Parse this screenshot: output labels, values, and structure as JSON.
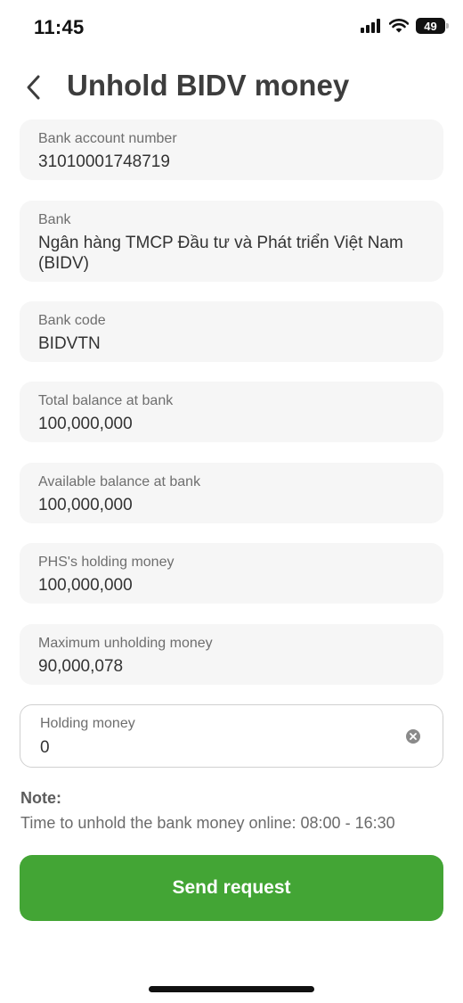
{
  "status_bar": {
    "time": "11:45",
    "battery_level": "49",
    "icons": [
      "signal-icon",
      "wifi-icon",
      "battery-icon"
    ]
  },
  "header": {
    "back_icon": "chevron-left-icon",
    "title": "Unhold BIDV money"
  },
  "fields": [
    {
      "label": "Bank account number",
      "value": "31010001748719"
    },
    {
      "label": "Bank",
      "value": "Ngân hàng TMCP Đầu tư và Phát triển Việt Nam (BIDV)"
    },
    {
      "label": "Bank code",
      "value": "BIDVTN"
    },
    {
      "label": "Total balance at bank",
      "value": "100,000,000"
    },
    {
      "label": "Available balance at bank",
      "value": "100,000,000"
    },
    {
      "label": "PHS's holding money",
      "value": "100,000,000"
    },
    {
      "label": "Maximum unholding money",
      "value": "90,000,078"
    }
  ],
  "holding_input": {
    "label": "Holding money",
    "value": "0",
    "clear_icon": "clear-circle-icon"
  },
  "note": {
    "title": "Note:",
    "text": "Time to unhold the bank money online: 08:00 - 16:30"
  },
  "send_button": {
    "label": "Send request"
  },
  "colors": {
    "primary_green": "#43a535",
    "field_background": "#f6f6f6",
    "title_text": "#3d3d3d"
  }
}
